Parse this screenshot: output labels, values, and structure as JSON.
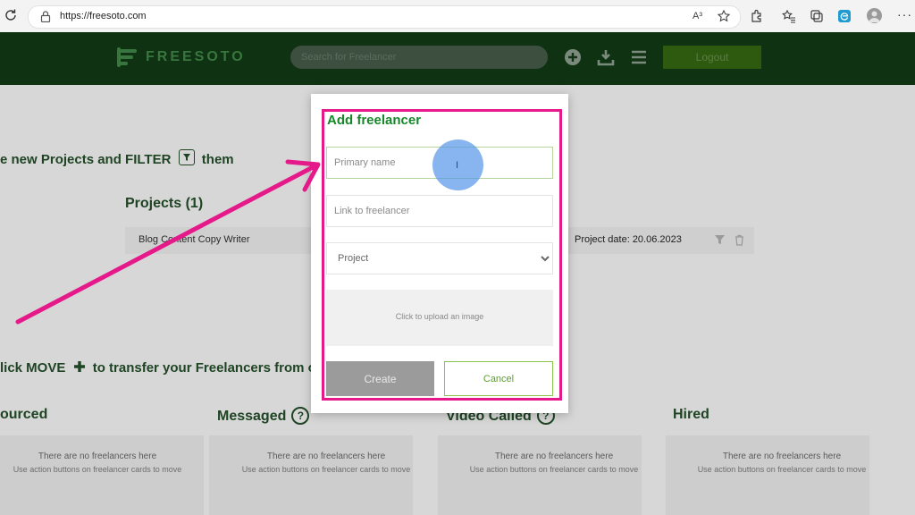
{
  "browser": {
    "url": "https://freesoto.com",
    "readaloud_glyph": "A³"
  },
  "header": {
    "logo_text": "FREESOTO",
    "search_placeholder": "Search for Freelancer",
    "logout_label": "Logout"
  },
  "page": {
    "instruction_prefix": "e new Projects and FILTER",
    "instruction_suffix": "them",
    "projects_heading": "Projects (1)",
    "project_name": "Blog Content Copy Writer",
    "project_date": "Project date: 20.06.2023",
    "move_instruction_prefix": "lick MOVE",
    "move_instruction_suffix": "to transfer your Freelancers from o",
    "columns": [
      {
        "title": "ourced",
        "empty_title": "There are no freelancers here",
        "empty_sub": "Use action buttons on freelancer cards to move"
      },
      {
        "title": "Messaged",
        "empty_title": "There are no freelancers here",
        "empty_sub": "Use action buttons on freelancer cards to move"
      },
      {
        "title": "Video Called",
        "empty_title": "There are no freelancers here",
        "empty_sub": "Use action buttons on freelancer cards to move"
      },
      {
        "title": "Hired",
        "empty_title": "There are no freelancers here",
        "empty_sub": "Use action buttons on freelancer cards to move"
      }
    ],
    "help_glyph": "?"
  },
  "modal": {
    "title": "Add freelancer",
    "primary_name_placeholder": "Primary name",
    "link_placeholder": "Link to freelancer",
    "project_selected": "Project",
    "upload_text": "Click to upload an image",
    "create_label": "Create",
    "cancel_label": "Cancel"
  },
  "colors": {
    "header_bg": "#0f3312",
    "brand_green": "#17872a",
    "highlight_pink": "#e6198a",
    "cursor_blue": "#5696e8"
  },
  "icons": {
    "cursor_glyph": "I"
  }
}
